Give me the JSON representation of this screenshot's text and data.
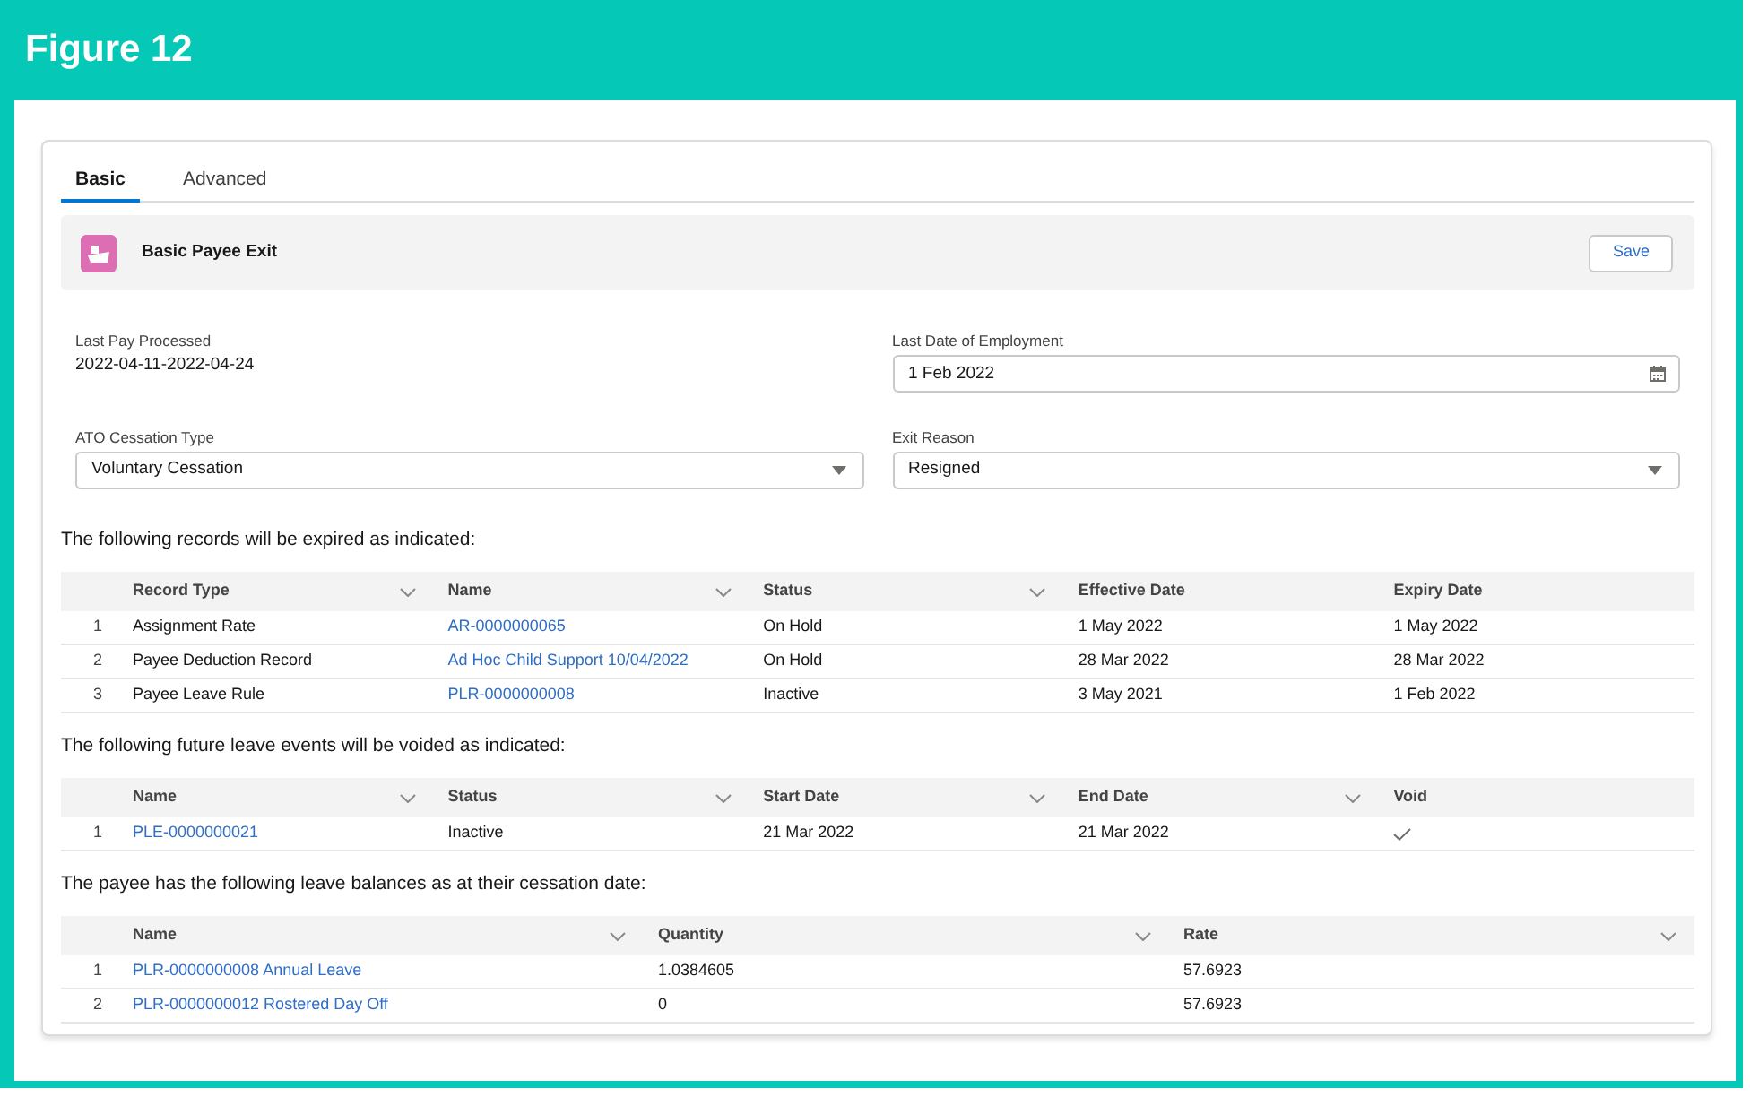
{
  "figure_title": "Figure 12",
  "tabs": [
    {
      "label": "Basic",
      "selected": true
    },
    {
      "label": "Advanced",
      "selected": false
    }
  ],
  "header": {
    "title": "Basic Payee Exit",
    "button": "Save"
  },
  "fields": [
    {
      "kind": "readonly",
      "label": "Last Pay Processed",
      "value": "2022-04-11-2022-04-24"
    },
    {
      "kind": "date",
      "label": "Last Date of Employment",
      "value": "1 Feb 2022"
    },
    {
      "kind": "select",
      "label": "ATO Cessation Type",
      "value": "Voluntary Cessation"
    },
    {
      "kind": "select",
      "label": "Exit Reason",
      "value": "Resigned"
    }
  ],
  "sections": [
    {
      "intro": "The following records will be expired as indicated:",
      "columns": [
        {
          "label": "Record Type",
          "kind": "text",
          "menu": true
        },
        {
          "label": "Name",
          "kind": "link",
          "menu": true
        },
        {
          "label": "Status",
          "kind": "text",
          "menu": true
        },
        {
          "label": "Effective Date",
          "kind": "text",
          "menu": false
        },
        {
          "label": "Expiry Date",
          "kind": "text",
          "menu": false
        }
      ],
      "rows": [
        {
          "number": "1",
          "cells": [
            "Assignment Rate",
            "AR-0000000065",
            "On Hold",
            "1 May 2022",
            "1 May 2022"
          ]
        },
        {
          "number": "2",
          "cells": [
            "Payee Deduction Record",
            "Ad Hoc Child Support 10/04/2022",
            "On Hold",
            "28 Mar 2022",
            "28 Mar 2022"
          ]
        },
        {
          "number": "3",
          "cells": [
            "Payee Leave Rule",
            "PLR-0000000008",
            "Inactive",
            "3 May 2021",
            "1 Feb 2022"
          ]
        }
      ]
    },
    {
      "intro": "The following future leave events will be voided as indicated:",
      "columns": [
        {
          "label": "Name",
          "kind": "link",
          "menu": true
        },
        {
          "label": "Status",
          "kind": "text",
          "menu": true
        },
        {
          "label": "Start Date",
          "kind": "text",
          "menu": true
        },
        {
          "label": "End Date",
          "kind": "text",
          "menu": true
        },
        {
          "label": "Void",
          "kind": "check",
          "menu": false
        }
      ],
      "rows": [
        {
          "number": "1",
          "cells": [
            "PLE-0000000021",
            "Inactive",
            "21 Mar 2022",
            "21 Mar 2022",
            true
          ]
        }
      ]
    },
    {
      "intro": "The payee has the following leave balances as at their cessation date:",
      "columns": [
        {
          "label": "Name",
          "kind": "link",
          "menu": true
        },
        {
          "label": "Quantity",
          "kind": "text",
          "menu": true
        },
        {
          "label": "Rate",
          "kind": "text",
          "menu": true
        }
      ],
      "rows": [
        {
          "number": "1",
          "cells": [
            "PLR-0000000008 Annual Leave",
            "1.0384605",
            "57.6923"
          ]
        },
        {
          "number": "2",
          "cells": [
            "PLR-0000000012 Rostered Day Off",
            "0",
            "57.6923"
          ]
        }
      ]
    }
  ]
}
